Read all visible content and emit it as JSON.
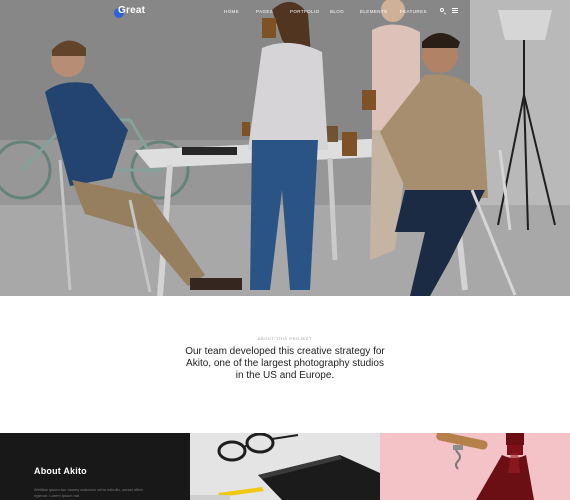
{
  "header": {
    "logo_text": "Great",
    "nav": [
      "HOME",
      "PAGES",
      "PORTFOLIO",
      "BLOG",
      "ELEMENTS",
      "FEATURES"
    ],
    "icons": [
      "search-icon",
      "menu-icon"
    ]
  },
  "hero": {
    "image": "photo-team-at-table"
  },
  "about_project": {
    "eyebrow": "ABOUT THIS PROJECT",
    "statement": "Our team developed this creative strategy for Akito, one of the largest photography studios in the US and Europe."
  },
  "tiles": {
    "about": {
      "title": "About Akito",
      "body": "Welltew ipsum too mosey autcossz cehu exbullu, soract often egtecor. Lorem ipsum hat"
    },
    "images": [
      "photo-desk-notebook-glasses",
      "photo-wine-bottle-corkscrew"
    ]
  },
  "colors": {
    "accent": "#2c62d6",
    "dark_tile": "#181818",
    "pink_tile": "#f3c3c8"
  }
}
